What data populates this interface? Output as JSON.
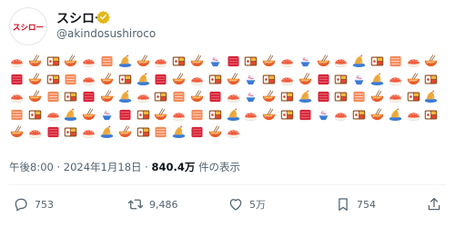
{
  "author": {
    "name": "スシロー",
    "handle": "@akindosushiroco",
    "avatar_text": "スシロー",
    "verified_color": "#e2b719"
  },
  "emoji_rows": [
    [
      "sushi",
      "ramen",
      "bento",
      "ramen",
      "sushi",
      "salmon",
      "tempura",
      "ramen",
      "sushi",
      "bento",
      "ramen",
      "shaved-ice",
      "tuna",
      "bento",
      "ramen",
      "sushi",
      "shaved-ice",
      "ramen",
      "sushi",
      "tempura",
      "bento",
      "salmon",
      "sushi",
      "ramen"
    ],
    [
      "tuna",
      "ramen",
      "bento",
      "salmon",
      "sushi",
      "ramen",
      "bento",
      "tempura",
      "tuna",
      "ramen",
      "sushi",
      "bento",
      "ramen",
      "shaved-ice",
      "bento",
      "sushi",
      "ramen",
      "tuna",
      "bento",
      "shaved-ice",
      "tempura",
      "sushi",
      "ramen",
      "bento"
    ],
    [
      "sushi",
      "ramen",
      "salmon",
      "bento",
      "tuna",
      "ramen",
      "tempura",
      "sushi",
      "bento",
      "salmon",
      "ramen",
      "tuna",
      "sushi",
      "shaved-ice",
      "ramen",
      "bento",
      "tempura",
      "tuna",
      "bento",
      "salmon",
      "ramen",
      "sushi",
      "bento",
      "tempura"
    ],
    [
      "salmon",
      "bento",
      "sushi",
      "tempura",
      "ramen",
      "shaved-ice",
      "tuna",
      "bento",
      "ramen",
      "sushi",
      "salmon",
      "bento",
      "tempura",
      "sushi",
      "ramen",
      "bento",
      "tuna",
      "shaved-ice",
      "sushi",
      "bento",
      "ramen",
      "tempura",
      "sushi",
      "bento"
    ],
    [
      "ramen",
      "sushi",
      "tuna",
      "bento",
      "sushi",
      "tempura",
      "ramen",
      "bento",
      "salmon",
      "tempura",
      "tuna",
      "ramen",
      "sushi"
    ]
  ],
  "meta": {
    "time": "午後8:00 · 2024年1月18日 · ",
    "views_count": "840.4万",
    "views_label": " 件の表示"
  },
  "actions": {
    "replies": "753",
    "reposts": "9,486",
    "likes": "5万",
    "bookmarks": "754"
  },
  "colors": {
    "text": "#0f1419",
    "muted": "#536471",
    "divider": "#eff3f4",
    "brand_red": "#d7000f"
  }
}
